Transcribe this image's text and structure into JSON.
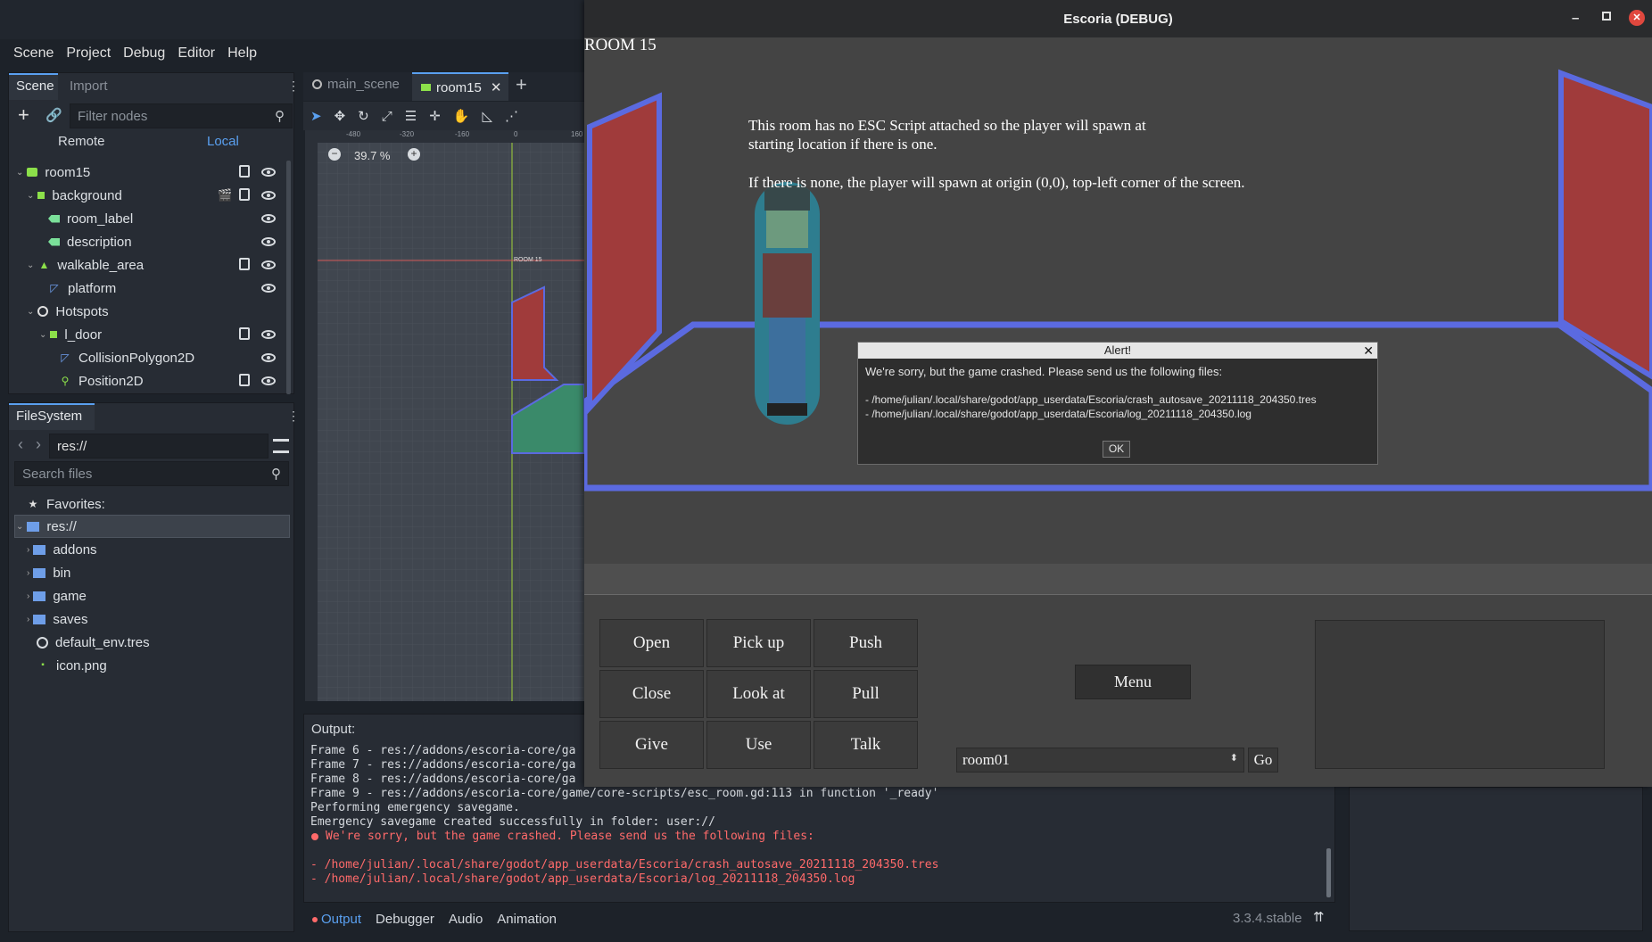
{
  "editor": {
    "menu": [
      "Scene",
      "Project",
      "Debug",
      "Editor",
      "Help"
    ],
    "scene_dock": {
      "tabs": [
        "Scene",
        "Import"
      ],
      "filter_placeholder": "Filter nodes",
      "remote_label": "Remote",
      "local_label": "Local",
      "tree": [
        {
          "label": "room15",
          "icon": "node2d-icon"
        },
        {
          "label": "background",
          "icon": "sprite-icon"
        },
        {
          "label": "room_label",
          "icon": "label-icon"
        },
        {
          "label": "description",
          "icon": "label-icon"
        },
        {
          "label": "walkable_area",
          "icon": "navigation-icon"
        },
        {
          "label": "platform",
          "icon": "polygon-icon"
        },
        {
          "label": "Hotspots",
          "icon": "circle-icon"
        },
        {
          "label": "l_door",
          "icon": "area-icon"
        },
        {
          "label": "CollisionPolygon2D",
          "icon": "polygon-icon"
        },
        {
          "label": "Position2D",
          "icon": "position-icon"
        }
      ]
    },
    "filesystem": {
      "title": "FileSystem",
      "path": "res://",
      "search_placeholder": "Search files",
      "favorites_label": "Favorites:",
      "items": [
        "res://",
        "addons",
        "bin",
        "game",
        "saves",
        "default_env.tres",
        "icon.png"
      ]
    },
    "viewport": {
      "tabs": [
        "main_scene",
        "room15"
      ],
      "zoom": "39.7 %",
      "ruler_labels": [
        "-480",
        "-320",
        "-160",
        "0",
        "160"
      ],
      "node_label": "ROOM 15"
    },
    "output": {
      "title": "Output:",
      "lines": [
        "Frame 6 - res://addons/escoria-core/ga",
        "Frame 7 - res://addons/escoria-core/ga",
        "Frame 8 - res://addons/escoria-core/ga",
        "Frame 9 - res://addons/escoria-core/game/core-scripts/esc_room.gd:113 in function '_ready'",
        "Performing emergency savegame.",
        "Emergency savegame created successfully in folder: user://"
      ],
      "error_lines": [
        "We're sorry, but the game crashed. Please send us the following files:",
        "",
        "- /home/julian/.local/share/godot/app_userdata/Escoria/crash_autosave_20211118_204350.tres",
        "- /home/julian/.local/share/godot/app_userdata/Escoria/log_20211118_204350.log"
      ],
      "bottom_tabs": [
        "Output",
        "Debugger",
        "Audio",
        "Animation"
      ],
      "version": "3.3.4.stable"
    }
  },
  "game": {
    "window_title": "Escoria (DEBUG)",
    "room_title": "ROOM 15",
    "description_1": "This room has no ESC Script attached so the player will spawn at",
    "description_2": "starting location if there is one.",
    "description_3": "If there is none, the player will spawn at origin (0,0), top-left corner of the screen.",
    "alert": {
      "title": "Alert!",
      "message": "We're sorry, but the game crashed. Please send us the following files:",
      "file1": "- /home/julian/.local/share/godot/app_userdata/Escoria/crash_autosave_20211118_204350.tres",
      "file2": "- /home/julian/.local/share/godot/app_userdata/Escoria/log_20211118_204350.log",
      "ok": "OK"
    },
    "verbs": [
      "Open",
      "Pick up",
      "Push",
      "Close",
      "Look at",
      "Pull",
      "Give",
      "Use",
      "Talk"
    ],
    "menu_button": "Menu",
    "room_select": "room01",
    "go_button": "Go"
  },
  "colors": {
    "accent": "#5aa0f0",
    "door": "#a03b3b",
    "walkable_outline": "#5b6ae0",
    "error": "#ff6a6a"
  }
}
